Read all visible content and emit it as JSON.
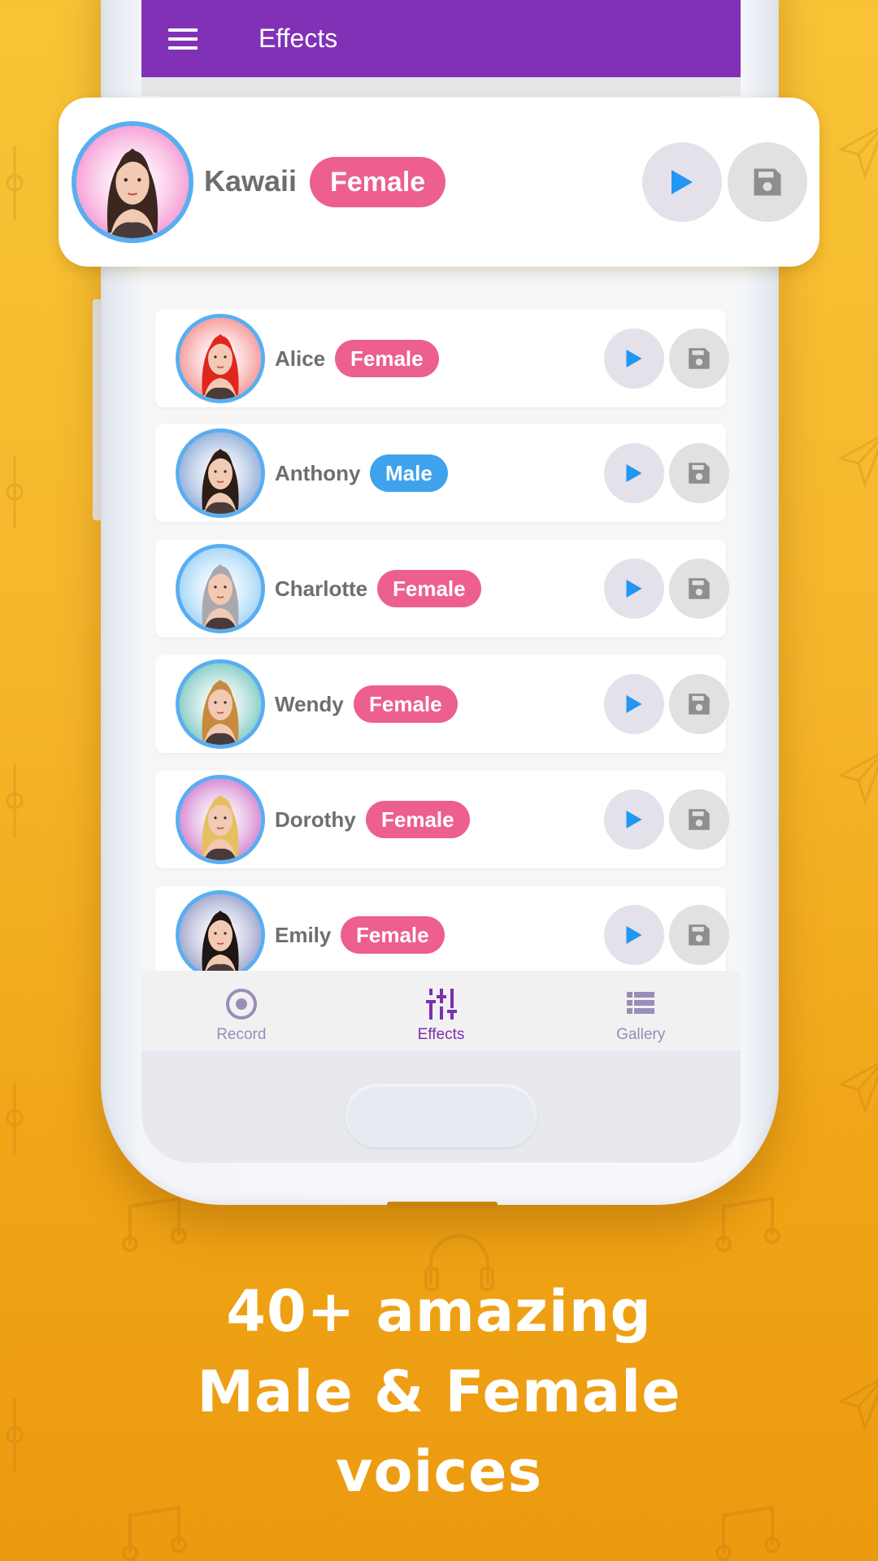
{
  "app": {
    "title": "Effects",
    "menu_icon": "hamburger-menu-icon"
  },
  "featured": {
    "name": "Kawaii",
    "gender": "Female",
    "avatar_bg": "#f7a3d8",
    "hair": "#3b2620"
  },
  "voices": [
    {
      "name": "",
      "gender": "",
      "partial": true,
      "avatar_bg": "#c9a4d8",
      "hair": "#3b2620"
    },
    {
      "name": "Alice",
      "gender": "Female",
      "avatar_bg": "#f7a0a0",
      "hair": "#e0261c"
    },
    {
      "name": "Anthony",
      "gender": "Male",
      "avatar_bg": "#9cb4dc",
      "hair": "#2b1d16"
    },
    {
      "name": "Charlotte",
      "gender": "Female",
      "avatar_bg": "#a9d8f8",
      "hair": "#a9a9ad"
    },
    {
      "name": "Wendy",
      "gender": "Female",
      "avatar_bg": "#8ed0c8",
      "hair": "#c88a3c"
    },
    {
      "name": "Dorothy",
      "gender": "Female",
      "avatar_bg": "#d890d4",
      "hair": "#e6c060"
    },
    {
      "name": "Emily",
      "gender": "Female",
      "avatar_bg": "#a8acd0",
      "hair": "#1e1614"
    }
  ],
  "nav": [
    {
      "label": "Record",
      "icon": "record-icon",
      "active": false
    },
    {
      "label": "Effects",
      "icon": "equalizer-icon",
      "active": true
    },
    {
      "label": "Gallery",
      "icon": "list-icon",
      "active": false
    }
  ],
  "promo": {
    "line1": "40+ amazing",
    "line2": "Male & Female",
    "line3": "voices"
  },
  "colors": {
    "accent": "#8131b5",
    "female_badge": "#ec5f8e",
    "male_badge": "#3ea3ec",
    "play_icon": "#2196f3",
    "save_icon": "#8e8e8e",
    "background": "#f5b52a"
  }
}
